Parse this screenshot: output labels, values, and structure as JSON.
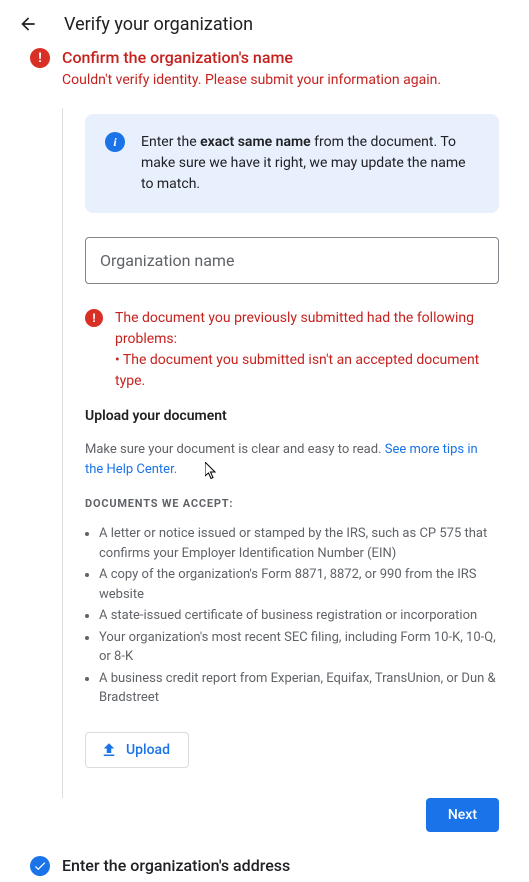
{
  "header": {
    "title": "Verify your organization"
  },
  "step1": {
    "title": "Confirm the organization's name",
    "subtitle": "Couldn't verify identity. Please submit your information again.",
    "info_prefix": "Enter the ",
    "info_strong": "exact same name",
    "info_suffix": " from the document. To make sure we have it right, we may update the name to match.",
    "input_placeholder": "Organization name",
    "error_intro": "The document you previously submitted had the following problems:",
    "error_bullet": "• The document you submitted isn't an accepted document type.",
    "upload_header": "Upload your document",
    "upload_tip_prefix": "Make sure your document is clear and easy to read. ",
    "upload_tip_link": "See more tips in the Help Center",
    "docs_accept_header": "DOCUMENTS WE ACCEPT:",
    "docs": [
      "A letter or notice issued or stamped by the IRS, such as CP 575 that confirms your Employer Identification Number (EIN)",
      "A copy of the organization's Form 8871, 8872, or 990 from the IRS website",
      "A state-issued certificate of business registration or incorporation",
      "Your organization's most recent SEC filing, including Form 10-K, 10-Q, or 8-K",
      "A business credit report from Experian, Equifax, TransUnion, or Dun & Bradstreet"
    ],
    "upload_btn": "Upload"
  },
  "next_btn": "Next",
  "step2": {
    "title": "Enter the organization's address"
  }
}
